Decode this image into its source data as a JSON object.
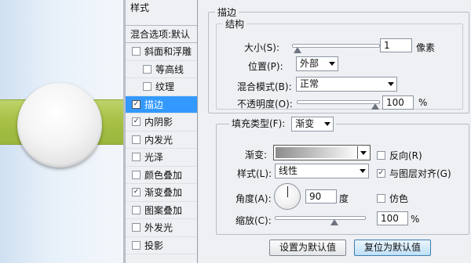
{
  "styles_panel": {
    "header": "样式",
    "blend_options": "混合选项:默认",
    "items": [
      {
        "label": "斜面和浮雕",
        "checked": false,
        "sub": false,
        "selected": false
      },
      {
        "label": "等高线",
        "checked": false,
        "sub": true,
        "selected": false
      },
      {
        "label": "纹理",
        "checked": false,
        "sub": true,
        "selected": false
      },
      {
        "label": "描边",
        "checked": true,
        "sub": false,
        "selected": true
      },
      {
        "label": "内阴影",
        "checked": true,
        "sub": false,
        "selected": false
      },
      {
        "label": "内发光",
        "checked": false,
        "sub": false,
        "selected": false
      },
      {
        "label": "光泽",
        "checked": false,
        "sub": false,
        "selected": false
      },
      {
        "label": "颜色叠加",
        "checked": false,
        "sub": false,
        "selected": false
      },
      {
        "label": "渐变叠加",
        "checked": true,
        "sub": false,
        "selected": false
      },
      {
        "label": "图案叠加",
        "checked": false,
        "sub": false,
        "selected": false
      },
      {
        "label": "外发光",
        "checked": false,
        "sub": false,
        "selected": false
      },
      {
        "label": "投影",
        "checked": false,
        "sub": false,
        "selected": false
      }
    ]
  },
  "stroke": {
    "title": "描边",
    "structure_title": "结构",
    "size_label": "大小(S):",
    "size_value": "1",
    "size_unit": "像素",
    "size_slider_fraction": 0.01,
    "position_label": "位置(P):",
    "position_value": "外部",
    "blend_mode_label": "混合模式(B):",
    "blend_mode_value": "正常",
    "opacity_label": "不透明度(O):",
    "opacity_value": "100",
    "opacity_unit": "%",
    "opacity_fraction": 1.0,
    "fill_type_label": "填充类型(F):",
    "fill_type_value": "渐变",
    "gradient_label": "渐变:",
    "reverse_label": "反向(R)",
    "reverse_checked": false,
    "style_label": "样式(L):",
    "style_value": "线性",
    "align_label": "与图层对齐(G)",
    "align_checked": true,
    "angle_label": "角度(A):",
    "angle_value": "90",
    "angle_unit": "度",
    "dither_label": "仿色",
    "dither_checked": false,
    "scale_label": "缩放(C):",
    "scale_value": "100",
    "scale_unit": "%",
    "scale_fraction": 0.67,
    "make_default_button": "设置为默认值",
    "reset_default_button": "复位为默认值"
  }
}
